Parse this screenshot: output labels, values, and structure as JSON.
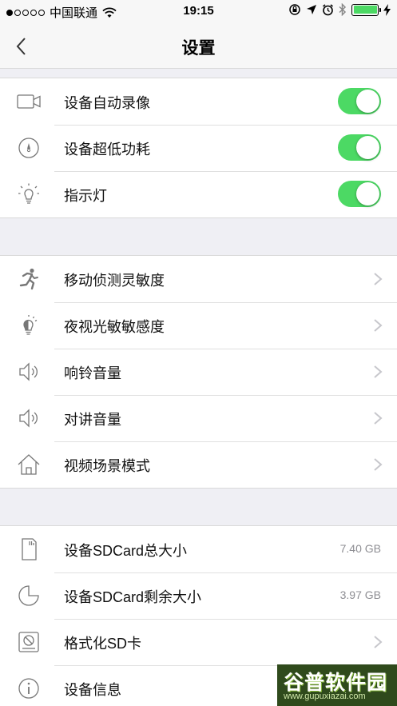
{
  "status_bar": {
    "carrier": "中国联通",
    "time": "19:15",
    "battery_color": "#4cd964"
  },
  "nav": {
    "title": "设置",
    "back_icon": "chevron-left-icon"
  },
  "group1": {
    "items": [
      {
        "label": "设备自动录像",
        "icon": "camera-icon",
        "toggle_on": true
      },
      {
        "label": "设备超低功耗",
        "icon": "compass-icon",
        "toggle_on": true
      },
      {
        "label": "指示灯",
        "icon": "lightbulb-icon",
        "toggle_on": true
      }
    ]
  },
  "group2": {
    "items": [
      {
        "label": "移动侦测灵敏度",
        "icon": "running-person-icon"
      },
      {
        "label": "夜视光敏敏感度",
        "icon": "night-light-icon"
      },
      {
        "label": "响铃音量",
        "icon": "speaker-icon"
      },
      {
        "label": "对讲音量",
        "icon": "speaker-icon"
      },
      {
        "label": "视频场景模式",
        "icon": "home-icon"
      }
    ]
  },
  "group3": {
    "items": [
      {
        "label": "设备SDCard总大小",
        "value": "7.40 GB",
        "icon": "sd-card-icon"
      },
      {
        "label": "设备SDCard剩余大小",
        "value": "3.97 GB",
        "icon": "pie-chart-icon"
      },
      {
        "label": "格式化SD卡",
        "icon": "format-drive-icon"
      },
      {
        "label": "设备信息",
        "icon": "info-icon"
      }
    ]
  },
  "watermark": {
    "title": "谷普软件园",
    "url": "www.gupuxiazai.com"
  },
  "colors": {
    "toggle_on": "#4cd964",
    "background": "#efeff4",
    "chevron": "#c7c7cc"
  }
}
